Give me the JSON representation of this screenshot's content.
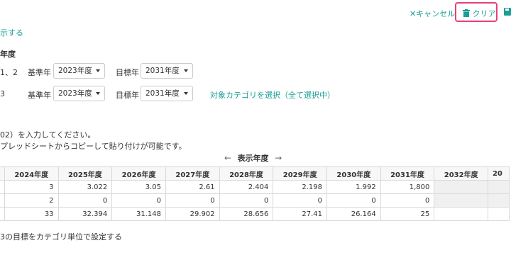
{
  "toolbar": {
    "cancel_icon": "x-icon",
    "cancel_label": "キャンセル",
    "clear_icon": "trash-icon",
    "clear_label": "クリア",
    "save_icon": "save-icon"
  },
  "show_link": "示する",
  "section_title": "年度",
  "rows": [
    {
      "prefix": "1、2",
      "base_label": "基準年",
      "base_value": "2023年度",
      "target_label": "目標年",
      "target_value": "2031年度"
    },
    {
      "prefix": "3",
      "base_label": "基準年",
      "base_value": "2023年度",
      "target_label": "目標年",
      "target_value": "2031年度",
      "category_link": "対象カテゴリを選択（全て選択中）"
    }
  ],
  "instructions": {
    "line1": "02）を入力してください。",
    "line2": "プレッドシートからコピーして貼り付けが可能です。"
  },
  "year_nav": {
    "prev": "←",
    "label": "表示年度",
    "next": "→"
  },
  "table": {
    "headers": [
      "2024年度",
      "2025年度",
      "2026年度",
      "2027年度",
      "2028年度",
      "2029年度",
      "2030年度",
      "2031年度",
      "2032年度",
      "20"
    ],
    "rows": [
      [
        "3",
        "3.022",
        "3.05",
        "2.61",
        "2.404",
        "2.198",
        "1.992",
        "1,800",
        "",
        ""
      ],
      [
        "2",
        "0",
        "0",
        "0",
        "0",
        "0",
        "0",
        "0",
        "",
        ""
      ],
      [
        "33",
        "32.394",
        "31.148",
        "29.902",
        "28.656",
        "27.41",
        "26.164",
        "25",
        "",
        ""
      ]
    ]
  },
  "footer_text": "3の目標をカテゴリ単位で設定する",
  "colors": {
    "accent": "#1a9e95",
    "highlight": "#e6407a"
  }
}
